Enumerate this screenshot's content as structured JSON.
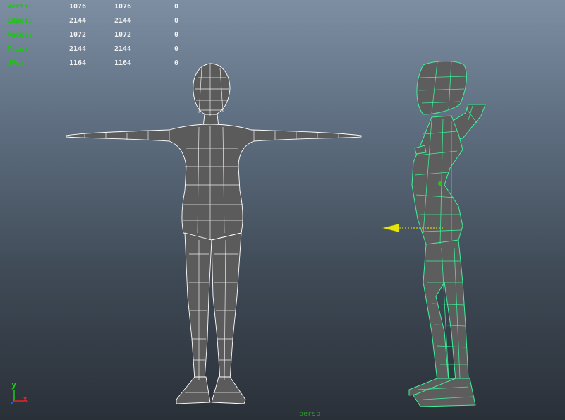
{
  "stats": [
    {
      "label": "Verts:",
      "v1": "1076",
      "v2": "1076",
      "v3": "0"
    },
    {
      "label": "Edges:",
      "v1": "2144",
      "v2": "2144",
      "v3": "0"
    },
    {
      "label": "Faces:",
      "v1": "1072",
      "v2": "1072",
      "v3": "0"
    },
    {
      "label": "Tris:",
      "v1": "2144",
      "v2": "2144",
      "v3": "0"
    },
    {
      "label": "UVs:",
      "v1": "1164",
      "v2": "1164",
      "v3": "0"
    }
  ],
  "axis": {
    "y": "y",
    "x": "x",
    "z": "z"
  },
  "camera": {
    "name": "persp"
  },
  "colors": {
    "selection": "#3cf29a",
    "wire": "#ffffff",
    "x_axis": "#e0262a",
    "y_axis": "#1fc91a",
    "z_axis": "#2966e8",
    "manipulator": "#e6e60f"
  }
}
